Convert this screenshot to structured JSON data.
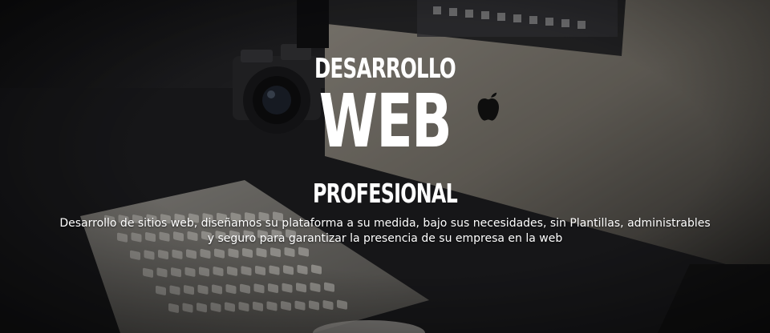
{
  "hero": {
    "line1": "DESARROLLO",
    "line2": "WEB",
    "line3": "PROFESIONAL",
    "description_1": "Desarrollo de sitios web, diseñamos su plataforma a su medida, bajo sus necesidades, sin Plantillas, administrables",
    "description_2": "y seguro para garantizar la presencia de su empresa en la web"
  },
  "colors": {
    "text": "#ffffff",
    "background": "#1a1a1c",
    "monitor": "#8a857d",
    "keyboard": "#b8b4ad"
  },
  "icons": [
    "apple-logo-icon",
    "camera-icon",
    "keyboard-icon",
    "monitor-icon",
    "mouse-icon"
  ]
}
